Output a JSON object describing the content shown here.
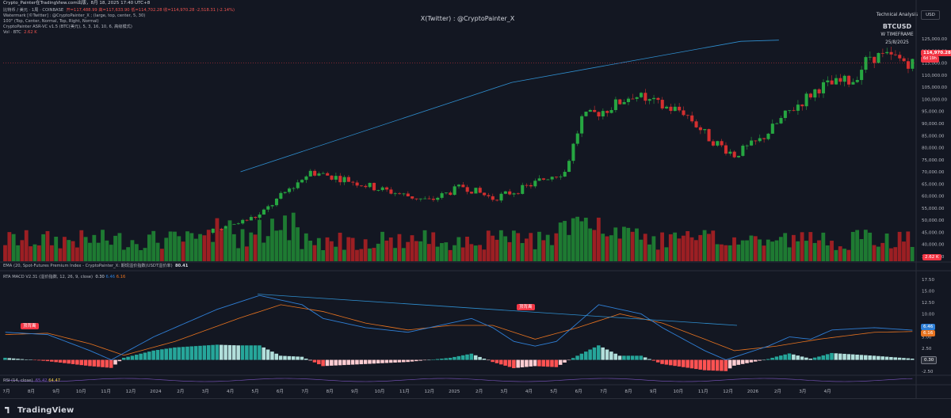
{
  "window_title": "Crypto_Painter在TradingView.com出版，8月 18, 2025 17:40 UTC+8",
  "legend": {
    "symbol_line": "比特币 / 美元 · 1周 · COINBASE",
    "ohlc": "开=117,488.99  高=117,633.90  低=114,702.28  收=114,970.28  -2,518.31 (-2.14%)",
    "watermark_line": "Watermark [©Twitter] : @CryptoPainter_X ; (large, top, center, 5, 30)",
    "params_line": "100\" (Top, Center, Normal, Top, Right, Normal)",
    "asr_line": "CryptoPainter ASR-VC v1.5 (BTC(美元), 5, 3, 16, 10, 6, 高级模式)",
    "vol_line": "Vol · BTC",
    "vol_value": "2.62 K",
    "ema_line": "EMA (20, Spot-Futures Premium Index - CryptoPainter_X: 期现溢价指数(USDT溢价率)",
    "ema_value": "80.41",
    "macd_line": "RTA MACD V2.31 (溢价指数, 12, 26, 9, close)",
    "macd_values": [
      "0.30",
      "6.46",
      "6.16"
    ],
    "rsi_line": "RSI (14, close)",
    "rsi_values": [
      "65.42",
      "64.47"
    ]
  },
  "watermark_title": "X(Twitter) : @CryptoPainter_X",
  "info_panel": {
    "heading": "Technical Analysis",
    "symbol": "BTCUSD",
    "timeframe": "W TIMEFRAME",
    "date": "25/8/2025"
  },
  "currency_button": "USD",
  "price_axis": [
    "125,000.00",
    "120,000.00",
    "115,000.00",
    "110,000.00",
    "105,000.00",
    "100,000.00",
    "95,000.00",
    "90,000.00",
    "85,000.00",
    "80,000.00",
    "75,000.00",
    "70,000.00",
    "65,000.00",
    "60,000.00",
    "55,000.00",
    "50,000.00",
    "45,000.00",
    "40,000.00",
    "35,000.00"
  ],
  "last_price_tag": "114,970.28",
  "last_price_sub": "6d 19h",
  "volume_tag": "2.62 K",
  "macd_axis": [
    "17.50",
    "15.00",
    "12.50",
    "10.00",
    "7.50",
    "5.00",
    "2.50",
    "0.00",
    "-2.50"
  ],
  "macd_tags": {
    "blue": "6.46",
    "orange": "6.16",
    "hist": "0.30"
  },
  "divergence_label": "顶背离",
  "time_axis": [
    "7月",
    "8月",
    "9月",
    "10月",
    "11月",
    "12月",
    "2024",
    "2月",
    "3月",
    "4月",
    "5月",
    "6月",
    "7月",
    "8月",
    "9月",
    "10月",
    "11月",
    "12月",
    "2025",
    "2月",
    "3月",
    "4月",
    "5月",
    "6月",
    "7月",
    "8月",
    "9月",
    "10月",
    "11月",
    "12月",
    "2026",
    "2月",
    "3月",
    "4月"
  ],
  "brand": "TradingView",
  "colors": {
    "background": "#131722",
    "up": "#26a641",
    "down": "#d32f2f",
    "trendline": "#2f8fd0",
    "macd_line": "#2f7fd6",
    "signal_line": "#e8731f"
  },
  "chart_data": {
    "type": "candlestick",
    "timeframe": "W",
    "ylim": [
      33000,
      128000
    ],
    "closes_sample": [
      29500,
      31000,
      36000,
      44000,
      42500,
      52000,
      63000,
      70000,
      66000,
      61000,
      67000,
      58000,
      69000,
      76000,
      96000,
      94000,
      102000,
      92000,
      82000,
      84000,
      96000,
      108000,
      117000,
      114970
    ],
    "last_close": 114970.28
  }
}
